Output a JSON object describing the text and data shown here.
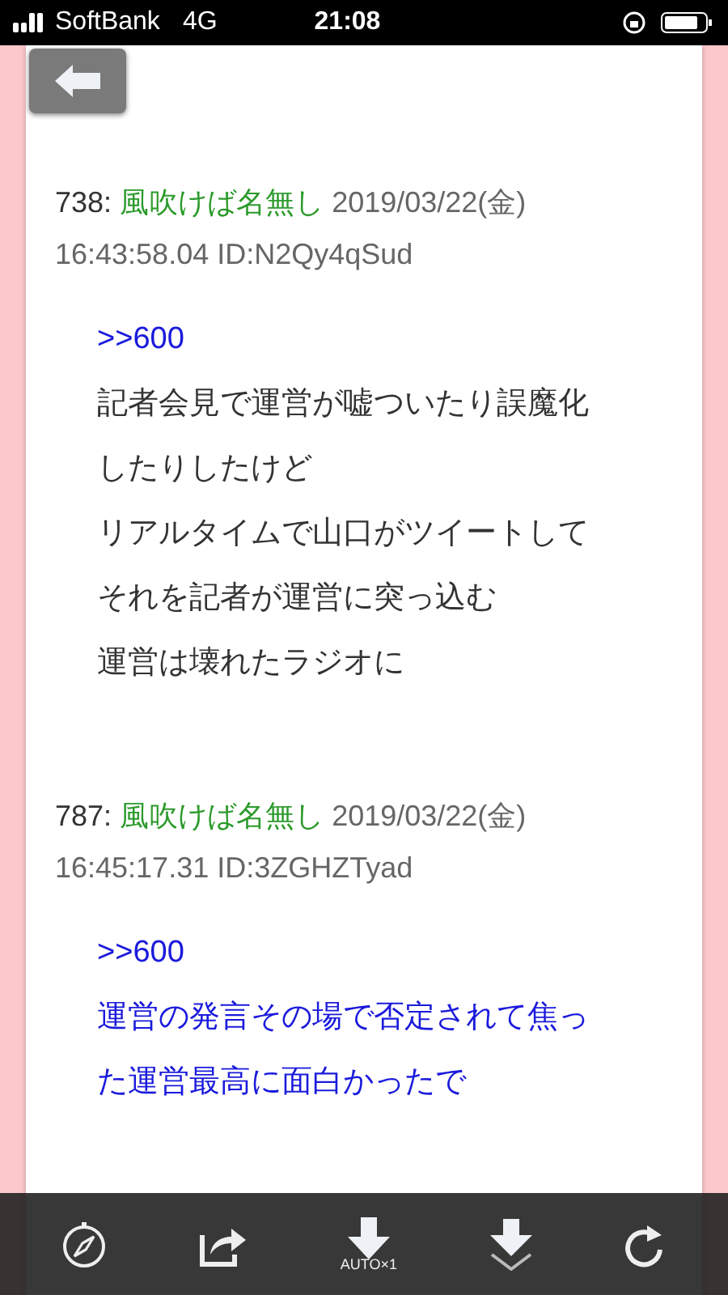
{
  "status_bar": {
    "carrier": "SoftBank",
    "network": "4G",
    "time": "21:08"
  },
  "posts": [
    {
      "number": "738:",
      "name": "風吹けば名無し",
      "date": "2019/03/22(金)",
      "time_id": "16:43:58.04 ID:N2Qy4qSud",
      "lines": [
        {
          "kind": "link",
          "text": ">>600"
        },
        {
          "kind": "text",
          "text": "記者会見で運営が嘘ついたり誤魔化"
        },
        {
          "kind": "text",
          "text": "したりしたけど"
        },
        {
          "kind": "text",
          "text": "リアルタイムで山口がツイートして"
        },
        {
          "kind": "text",
          "text": "それを記者が運営に突っ込む"
        },
        {
          "kind": "text",
          "text": "運営は壊れたラジオに"
        }
      ]
    },
    {
      "number": "787:",
      "name": "風吹けば名無し",
      "date": "2019/03/22(金)",
      "time_id": "16:45:17.31 ID:3ZGHZTyad",
      "lines": [
        {
          "kind": "link",
          "text": ">>600"
        },
        {
          "kind": "link",
          "text": "運営の発言その場で否定されて焦っ"
        },
        {
          "kind": "link",
          "text": "た運営最高に面白かったで"
        }
      ]
    }
  ],
  "toolbar": {
    "auto_label": "AUTO×1"
  }
}
